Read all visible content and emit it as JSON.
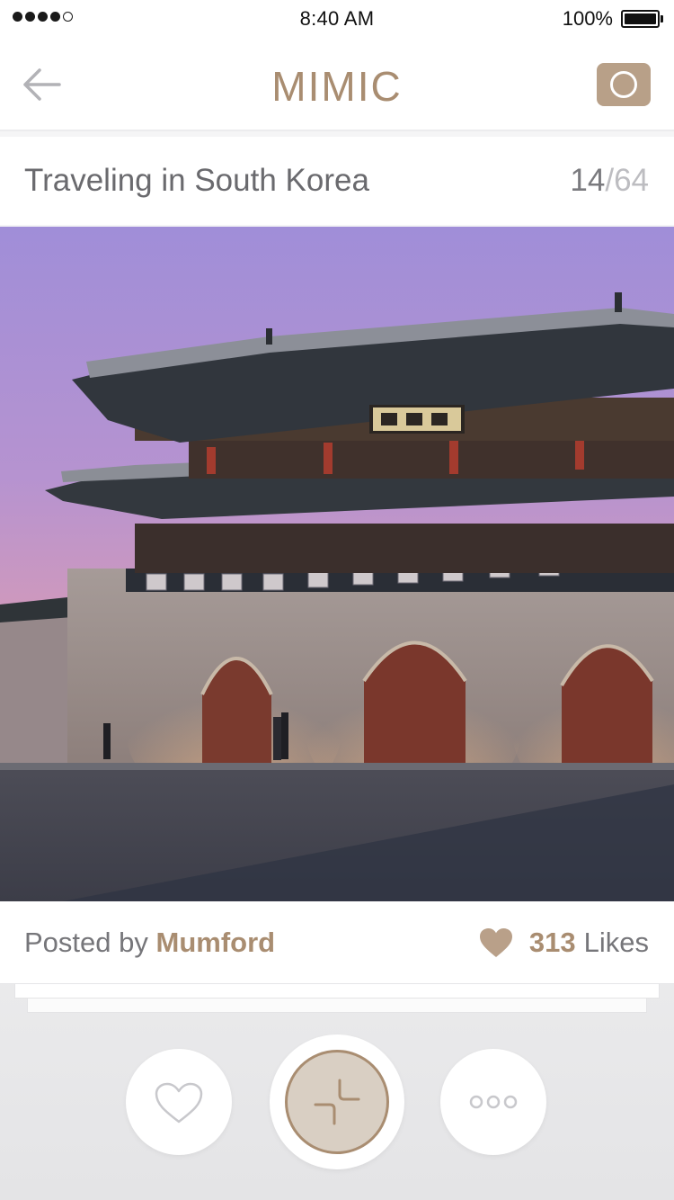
{
  "status_bar": {
    "time": "8:40 AM",
    "battery_percent": "100%",
    "signal_bars_filled": 4,
    "signal_bars_total": 5
  },
  "nav": {
    "title": "MIMIC",
    "back_icon": "arrow-left-icon",
    "camera_icon": "camera-icon"
  },
  "album": {
    "title": "Traveling in South Korea",
    "current_index": "14",
    "separator": "/",
    "total": "64"
  },
  "post": {
    "posted_by_label": "Posted by",
    "author": "Mumford",
    "likes_count": "313",
    "likes_label": "Likes",
    "likes_icon": "heart-filled-icon"
  },
  "actions": {
    "like_icon": "heart-outline-icon",
    "main_icon": "plus-split-icon",
    "more_icon": "more-dots-icon"
  },
  "colors": {
    "accent": "#a98d71",
    "accent_light": "#d9cfc3",
    "camera_button": "#b8a088",
    "text_gray": "#6e6e73",
    "muted_gray": "#bdbdc1"
  }
}
